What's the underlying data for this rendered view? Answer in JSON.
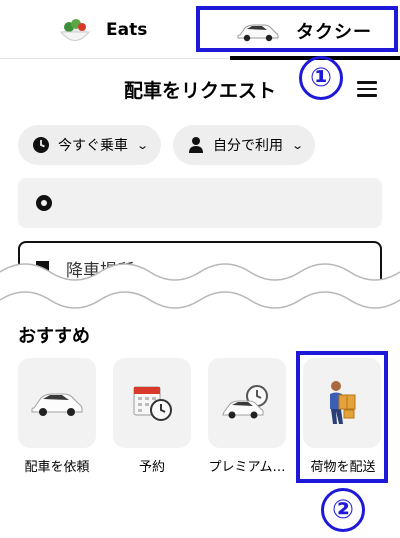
{
  "tabs": {
    "eats_label": "Eats",
    "taxi_label": "タクシー"
  },
  "callouts": {
    "one": "①",
    "two": "②"
  },
  "header": {
    "title": "配車をリクエスト"
  },
  "filters": {
    "time_label": "今すぐ乗車",
    "rider_label": "自分で利用"
  },
  "route": {
    "pickup_value": "",
    "dropoff_placeholder": "降車場所"
  },
  "recommendations": {
    "title": "おすすめ",
    "items": [
      {
        "label": "配車を依頼",
        "icon": "taxi-car-icon"
      },
      {
        "label": "予約",
        "icon": "calendar-clock-icon"
      },
      {
        "label": "プレミアム…",
        "icon": "premium-car-clock-icon"
      },
      {
        "label": "荷物を配送",
        "icon": "package-courier-icon"
      }
    ]
  },
  "colors": {
    "annotation": "#1e18d8",
    "tile": "#f2f2f2",
    "pill": "#eeeeee"
  }
}
